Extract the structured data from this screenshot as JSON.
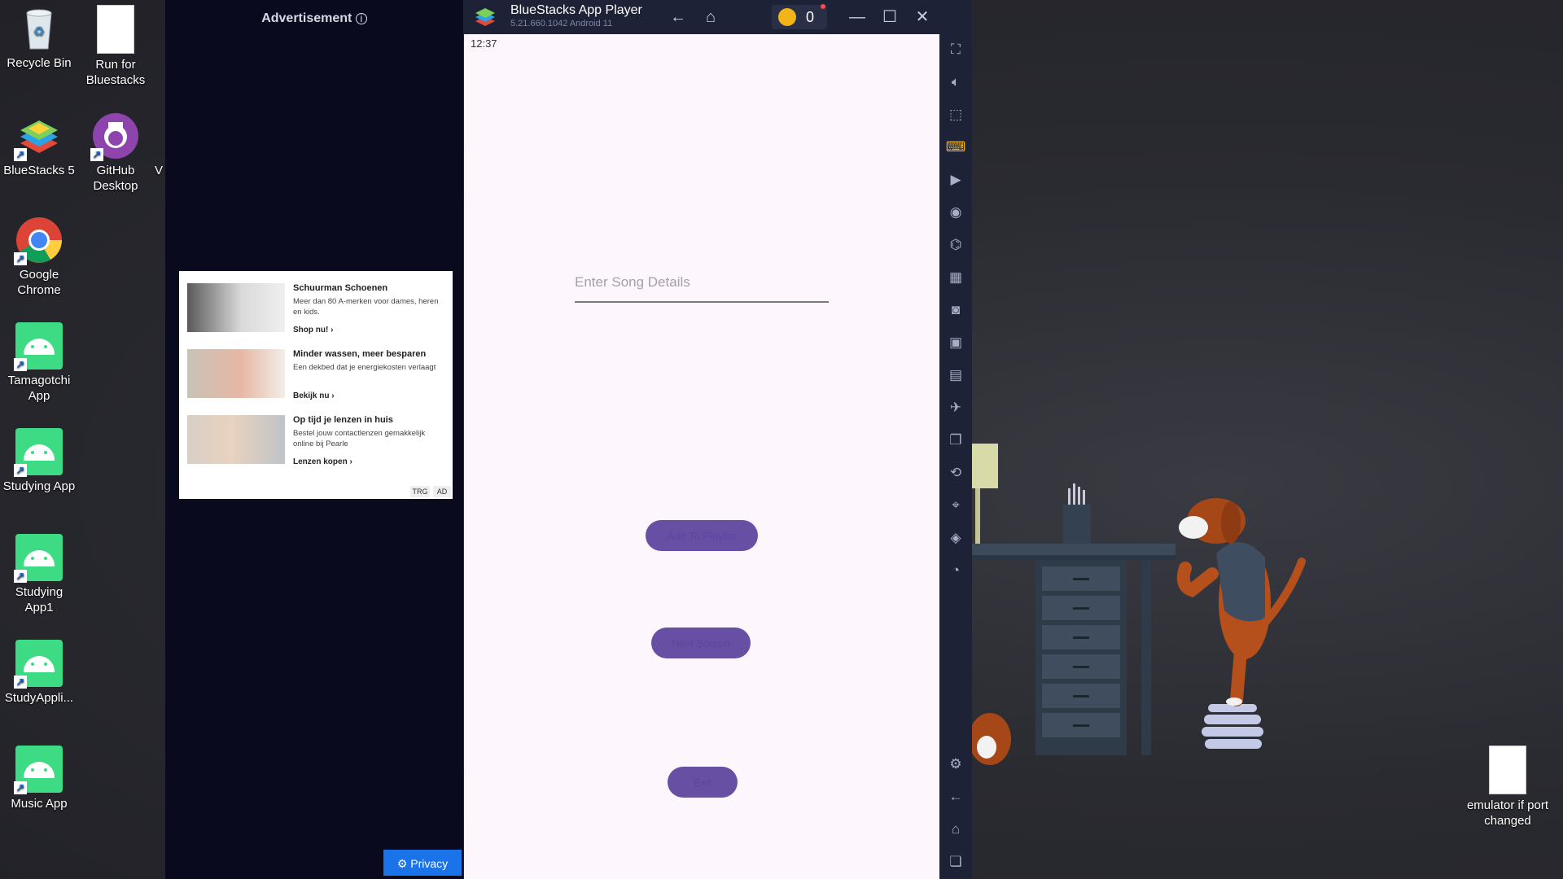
{
  "desktop": {
    "icons": [
      {
        "label": "Recycle Bin",
        "icon": "recycle-bin-icon"
      },
      {
        "label": "Run for Bluestacks",
        "icon": "file-icon"
      },
      {
        "label": "BlueStacks 5",
        "icon": "bluestacks-icon"
      },
      {
        "label": "GitHub Desktop",
        "icon": "github-icon"
      },
      {
        "label": "V",
        "icon": ""
      },
      {
        "label": "Google Chrome",
        "icon": "chrome-icon"
      },
      {
        "label": "Tamagotchi App",
        "icon": "android-icon"
      },
      {
        "label": "Studying App",
        "icon": "android-icon"
      },
      {
        "label": "Studying App1",
        "icon": "android-icon"
      },
      {
        "label": "StudyAppli...",
        "icon": "android-icon"
      },
      {
        "label": "Music App",
        "icon": "android-icon"
      },
      {
        "label": "emulator if port changed",
        "icon": "file-icon"
      }
    ]
  },
  "ad": {
    "title": "Advertisement",
    "items": [
      {
        "headline": "Schuurman Schoenen",
        "text": "Meer dan 80 A-merken voor dames, heren en kids.",
        "link": "Shop nu!"
      },
      {
        "headline": "Minder wassen, meer besparen",
        "text": "Een dekbed dat je energiekosten verlaagt",
        "link": "Bekijk nu"
      },
      {
        "headline": "Op tijd je lenzen in huis",
        "text": "Bestel jouw contactlenzen gemakkelijk online bij Pearle",
        "link": "Lenzen kopen"
      }
    ],
    "badge_trg": "TRG",
    "badge_ad": "AD",
    "privacy": "Privacy"
  },
  "bluestacks": {
    "title": "BlueStacks App Player",
    "version": "5.21.660.1042  Android 11",
    "coins": "0",
    "sidebar_icons": [
      "fullscreen-icon",
      "volume-icon",
      "pointer-icon",
      "keyboard-icon",
      "macro-icon",
      "sync-icon",
      "gamepad-icon",
      "apk-icon",
      "screenshot-icon",
      "record-icon",
      "media-icon",
      "airplane-icon",
      "multi-instance-icon",
      "rotate-icon",
      "location-icon",
      "layers-icon",
      "performance-icon",
      "settings-icon",
      "back-icon",
      "home-icon",
      "recents-icon"
    ]
  },
  "app": {
    "clock": "12:37",
    "song_placeholder": "Enter Song Details",
    "song_value": "",
    "add_button": "Add To Playlist",
    "next_button": "Next Screen",
    "exit_button": "Exit"
  }
}
